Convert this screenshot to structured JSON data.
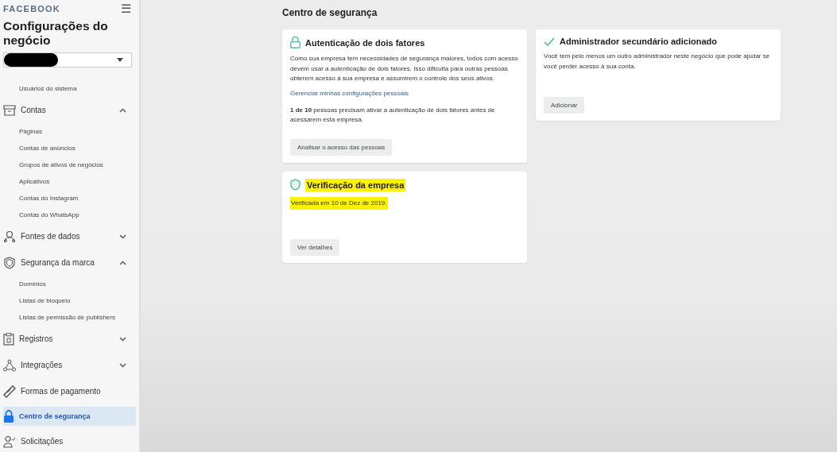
{
  "sidebar": {
    "brand": "FACEBOOK",
    "menu_glyph": "☰",
    "title": "Configurações do negócio",
    "selector": {
      "redacted": true
    },
    "items": [
      {
        "kind": "sub",
        "label": "Usuários do sistema",
        "selected": false
      },
      {
        "kind": "group",
        "label": "Contas",
        "expanded": true,
        "selected": false,
        "children": [
          {
            "label": "Páginas",
            "selected": false
          },
          {
            "label": "Contas de anúncios",
            "selected": false
          },
          {
            "label": "Grupos de ativos de negócios",
            "selected": false
          },
          {
            "label": "Aplicativos",
            "selected": false
          },
          {
            "label": "Contas do Instagram",
            "selected": false
          },
          {
            "label": "Contas do WhatsApp",
            "selected": false
          }
        ]
      },
      {
        "kind": "group",
        "label": "Fontes de dados",
        "expanded": false,
        "selected": false
      },
      {
        "kind": "group",
        "label": "Segurança da marca",
        "expanded": true,
        "selected": false,
        "children": [
          {
            "label": "Domínios",
            "selected": false
          },
          {
            "label": "Listas de bloqueio",
            "selected": false
          },
          {
            "label": "Listas de permissão de publishers",
            "selected": false
          }
        ]
      },
      {
        "kind": "group",
        "label": "Registros",
        "expanded": false,
        "selected": false
      },
      {
        "kind": "group",
        "label": "Integrações",
        "expanded": false,
        "selected": false
      },
      {
        "kind": "link",
        "label": "Formas de pagamento",
        "selected": false
      },
      {
        "kind": "link",
        "label": "Centro de segurança",
        "selected": true
      },
      {
        "kind": "link",
        "label": "Solicitações",
        "selected": false
      }
    ]
  },
  "main": {
    "title": "Centro de segurança",
    "cards": [
      {
        "title": "Autenticação de dois fatores",
        "highlighted": false,
        "body": "Como sua empresa tem necessidades de segurança maiores, todos com acesso devem usar a autenticação de dois fatores. Isso dificulta para outras pessoas obterem acesso à sua empresa e assumirem o controle dos seus ativos.",
        "link": "Gerenciar minhas configurações pessoais",
        "note": "**1 de 10** pessoas precisam ativar a autenticação de dois fatores antes de acessarem esta empresa.",
        "button": "Analisar o acesso das pessoas"
      },
      {
        "title": "Administrador secundário adicionado",
        "highlighted": false,
        "body": "Você tem pelo menos um outro administrador neste negócio que pode ajudar se você perder acesso à sua conta.",
        "button": "Adicionar"
      },
      {
        "title": "Verificação da empresa",
        "highlighted": true,
        "body": "Verificada em 10 de Dez de 2019.",
        "button": "Ver detalhes"
      }
    ]
  }
}
